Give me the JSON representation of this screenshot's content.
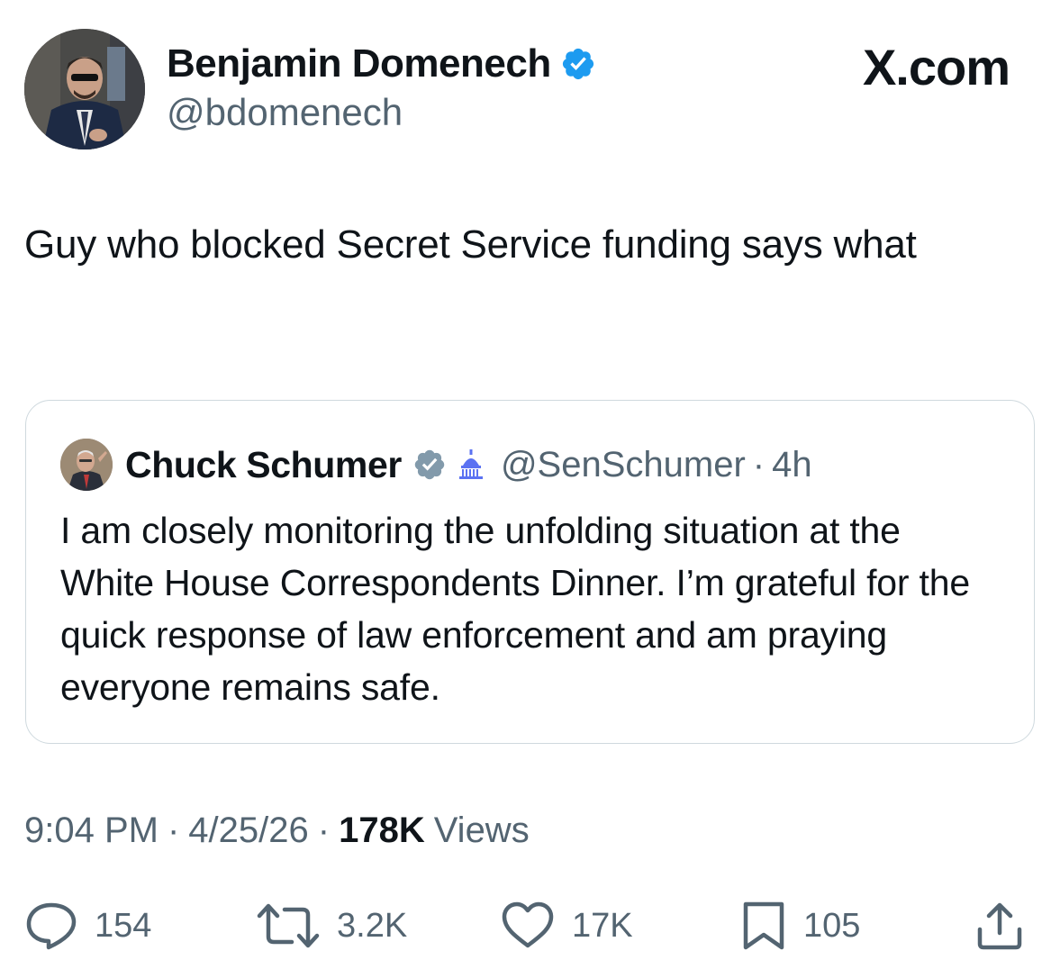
{
  "author": {
    "name": "Benjamin Domenech",
    "handle": "@bdomenech",
    "verified": true
  },
  "brand": "X.com",
  "tweet": {
    "text": "Guy who blocked Secret Service funding says what"
  },
  "quoted_tweet": {
    "name": "Chuck Schumer",
    "verified": true,
    "affiliation_icon": "capitol-icon",
    "handle": "@SenSchumer",
    "separator": "·",
    "time": "4h",
    "text": "I am closely monitoring the unfolding situation at the White House Correspondents Dinner. I’m grateful for the quick response of law enforcement and am praying everyone remains safe."
  },
  "meta": {
    "time": "9:04 PM",
    "separator": "·",
    "date": "4/25/26",
    "views_count": "178K",
    "views_label": "Views"
  },
  "actions": {
    "replies": "154",
    "reposts": "3.2K",
    "likes": "17K",
    "bookmarks": "105"
  },
  "colors": {
    "text_primary": "#0f1419",
    "text_secondary": "#536471",
    "verified_blue": "#1d9bf0",
    "border": "#cfd9de",
    "affiliation_blue": "#5b72f2"
  }
}
